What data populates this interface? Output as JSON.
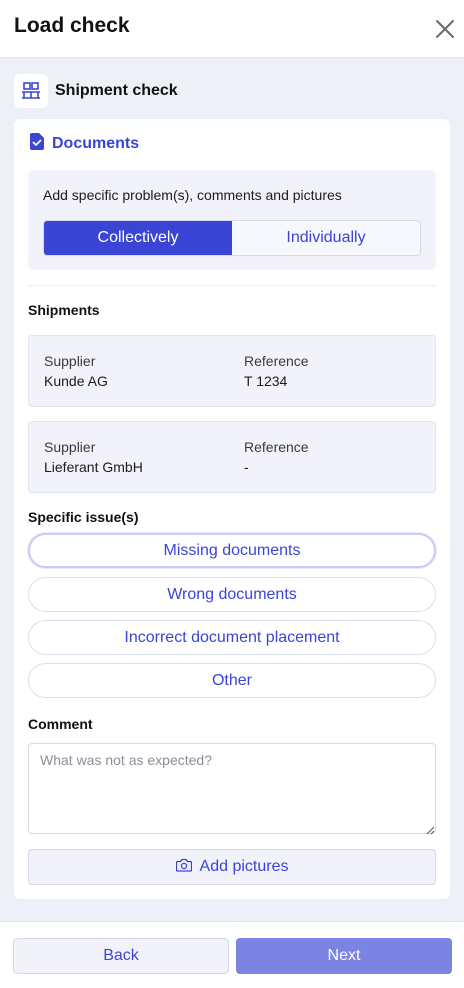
{
  "header": {
    "title": "Load check",
    "close_icon": "close-icon"
  },
  "section": {
    "label": "Shipment check",
    "icon": "pallet-icon"
  },
  "documents": {
    "label": "Documents",
    "icon": "document-check-icon",
    "hint": "Add specific problem(s), comments and pictures",
    "mode_options": [
      "Collectively",
      "Individually"
    ],
    "selected_mode": "Collectively"
  },
  "shipments": {
    "label": "Shipments",
    "items": [
      {
        "supplier_label": "Supplier",
        "supplier": "Kunde AG",
        "reference_label": "Reference",
        "reference": "T 1234"
      },
      {
        "supplier_label": "Supplier",
        "supplier": "Lieferant GmbH",
        "reference_label": "Reference",
        "reference": "-"
      }
    ]
  },
  "issues": {
    "label": "Specific issue(s)",
    "options": [
      "Missing documents",
      "Wrong documents",
      "Incorrect document placement",
      "Other"
    ]
  },
  "comment": {
    "label": "Comment",
    "placeholder": "What was not as expected?",
    "value": ""
  },
  "pictures": {
    "label": "Add pictures",
    "icon": "camera-icon"
  },
  "footer": {
    "back_label": "Back",
    "next_label": "Next"
  },
  "colors": {
    "accent": "#3a45d6",
    "accent_disabled": "#7b84e3",
    "panel": "#f1f2fa",
    "background": "#eef0f7"
  }
}
